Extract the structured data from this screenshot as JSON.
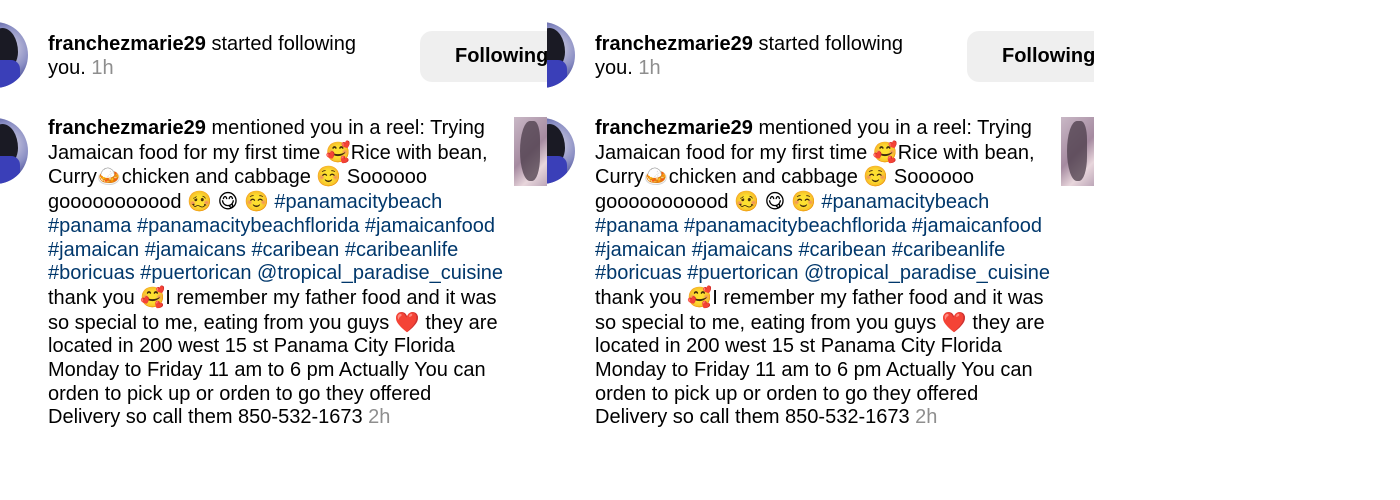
{
  "notifications": [
    {
      "username": "franchezmarie29",
      "action": "started following you.",
      "time": "1h",
      "button_label": "Following"
    },
    {
      "username": "franchezmarie29",
      "action": "mentioned you in a reel:",
      "caption_1": "Trying Jamaican food for my first time",
      "caption_2": "Rice with bean, Curry",
      "caption_3": "chicken and cabbage",
      "caption_4": "Soooooo gooooooooood",
      "hashtags": "#panamacitybeach #panama #panamacitybeachflorida #jamaicanfood #jamaican #jamaicans #caribean #caribeanlife #boricuas #puertorican",
      "mention": "@tropical_paradise_cuisine",
      "caption_5": "thank you",
      "caption_6": "I remember my father food and it was so special to me, eating from you guys",
      "caption_7": "they are located in 200 west 15 st Panama City Florida Monday to Friday 11 am to 6 pm Actually You can orden to pick up or orden to go they offered Delivery so call them 850-532-1673",
      "time": "2h"
    }
  ],
  "emoji": {
    "smiling_hearts": "🥰",
    "curry": "🍛",
    "relieved": "☺️",
    "woozy": "🥴",
    "yum": "😋",
    "heart": "❤️"
  }
}
